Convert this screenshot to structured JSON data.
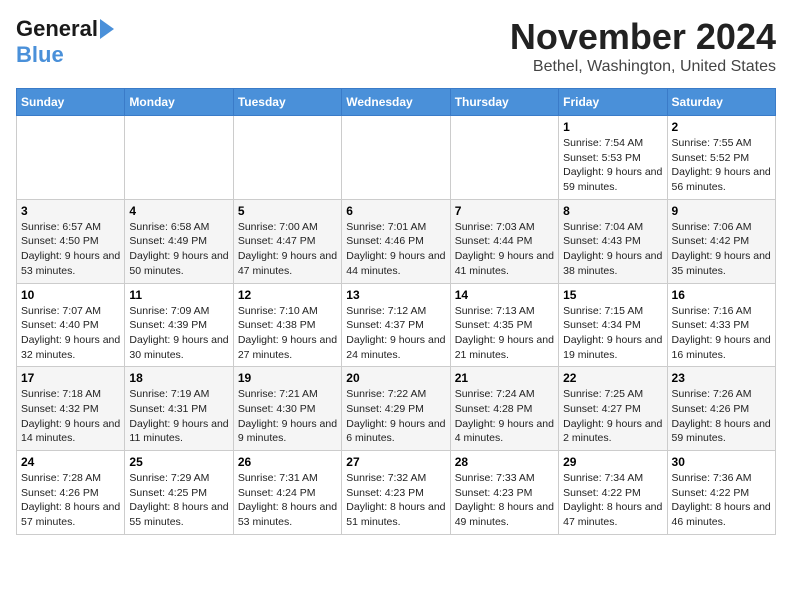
{
  "header": {
    "logo_line1": "General",
    "logo_line2": "Blue",
    "month": "November 2024",
    "location": "Bethel, Washington, United States"
  },
  "days_of_week": [
    "Sunday",
    "Monday",
    "Tuesday",
    "Wednesday",
    "Thursday",
    "Friday",
    "Saturday"
  ],
  "weeks": [
    [
      {
        "day": "",
        "info": ""
      },
      {
        "day": "",
        "info": ""
      },
      {
        "day": "",
        "info": ""
      },
      {
        "day": "",
        "info": ""
      },
      {
        "day": "",
        "info": ""
      },
      {
        "day": "1",
        "info": "Sunrise: 7:54 AM\nSunset: 5:53 PM\nDaylight: 9 hours and 59 minutes."
      },
      {
        "day": "2",
        "info": "Sunrise: 7:55 AM\nSunset: 5:52 PM\nDaylight: 9 hours and 56 minutes."
      }
    ],
    [
      {
        "day": "3",
        "info": "Sunrise: 6:57 AM\nSunset: 4:50 PM\nDaylight: 9 hours and 53 minutes."
      },
      {
        "day": "4",
        "info": "Sunrise: 6:58 AM\nSunset: 4:49 PM\nDaylight: 9 hours and 50 minutes."
      },
      {
        "day": "5",
        "info": "Sunrise: 7:00 AM\nSunset: 4:47 PM\nDaylight: 9 hours and 47 minutes."
      },
      {
        "day": "6",
        "info": "Sunrise: 7:01 AM\nSunset: 4:46 PM\nDaylight: 9 hours and 44 minutes."
      },
      {
        "day": "7",
        "info": "Sunrise: 7:03 AM\nSunset: 4:44 PM\nDaylight: 9 hours and 41 minutes."
      },
      {
        "day": "8",
        "info": "Sunrise: 7:04 AM\nSunset: 4:43 PM\nDaylight: 9 hours and 38 minutes."
      },
      {
        "day": "9",
        "info": "Sunrise: 7:06 AM\nSunset: 4:42 PM\nDaylight: 9 hours and 35 minutes."
      }
    ],
    [
      {
        "day": "10",
        "info": "Sunrise: 7:07 AM\nSunset: 4:40 PM\nDaylight: 9 hours and 32 minutes."
      },
      {
        "day": "11",
        "info": "Sunrise: 7:09 AM\nSunset: 4:39 PM\nDaylight: 9 hours and 30 minutes."
      },
      {
        "day": "12",
        "info": "Sunrise: 7:10 AM\nSunset: 4:38 PM\nDaylight: 9 hours and 27 minutes."
      },
      {
        "day": "13",
        "info": "Sunrise: 7:12 AM\nSunset: 4:37 PM\nDaylight: 9 hours and 24 minutes."
      },
      {
        "day": "14",
        "info": "Sunrise: 7:13 AM\nSunset: 4:35 PM\nDaylight: 9 hours and 21 minutes."
      },
      {
        "day": "15",
        "info": "Sunrise: 7:15 AM\nSunset: 4:34 PM\nDaylight: 9 hours and 19 minutes."
      },
      {
        "day": "16",
        "info": "Sunrise: 7:16 AM\nSunset: 4:33 PM\nDaylight: 9 hours and 16 minutes."
      }
    ],
    [
      {
        "day": "17",
        "info": "Sunrise: 7:18 AM\nSunset: 4:32 PM\nDaylight: 9 hours and 14 minutes."
      },
      {
        "day": "18",
        "info": "Sunrise: 7:19 AM\nSunset: 4:31 PM\nDaylight: 9 hours and 11 minutes."
      },
      {
        "day": "19",
        "info": "Sunrise: 7:21 AM\nSunset: 4:30 PM\nDaylight: 9 hours and 9 minutes."
      },
      {
        "day": "20",
        "info": "Sunrise: 7:22 AM\nSunset: 4:29 PM\nDaylight: 9 hours and 6 minutes."
      },
      {
        "day": "21",
        "info": "Sunrise: 7:24 AM\nSunset: 4:28 PM\nDaylight: 9 hours and 4 minutes."
      },
      {
        "day": "22",
        "info": "Sunrise: 7:25 AM\nSunset: 4:27 PM\nDaylight: 9 hours and 2 minutes."
      },
      {
        "day": "23",
        "info": "Sunrise: 7:26 AM\nSunset: 4:26 PM\nDaylight: 8 hours and 59 minutes."
      }
    ],
    [
      {
        "day": "24",
        "info": "Sunrise: 7:28 AM\nSunset: 4:26 PM\nDaylight: 8 hours and 57 minutes."
      },
      {
        "day": "25",
        "info": "Sunrise: 7:29 AM\nSunset: 4:25 PM\nDaylight: 8 hours and 55 minutes."
      },
      {
        "day": "26",
        "info": "Sunrise: 7:31 AM\nSunset: 4:24 PM\nDaylight: 8 hours and 53 minutes."
      },
      {
        "day": "27",
        "info": "Sunrise: 7:32 AM\nSunset: 4:23 PM\nDaylight: 8 hours and 51 minutes."
      },
      {
        "day": "28",
        "info": "Sunrise: 7:33 AM\nSunset: 4:23 PM\nDaylight: 8 hours and 49 minutes."
      },
      {
        "day": "29",
        "info": "Sunrise: 7:34 AM\nSunset: 4:22 PM\nDaylight: 8 hours and 47 minutes."
      },
      {
        "day": "30",
        "info": "Sunrise: 7:36 AM\nSunset: 4:22 PM\nDaylight: 8 hours and 46 minutes."
      }
    ]
  ]
}
